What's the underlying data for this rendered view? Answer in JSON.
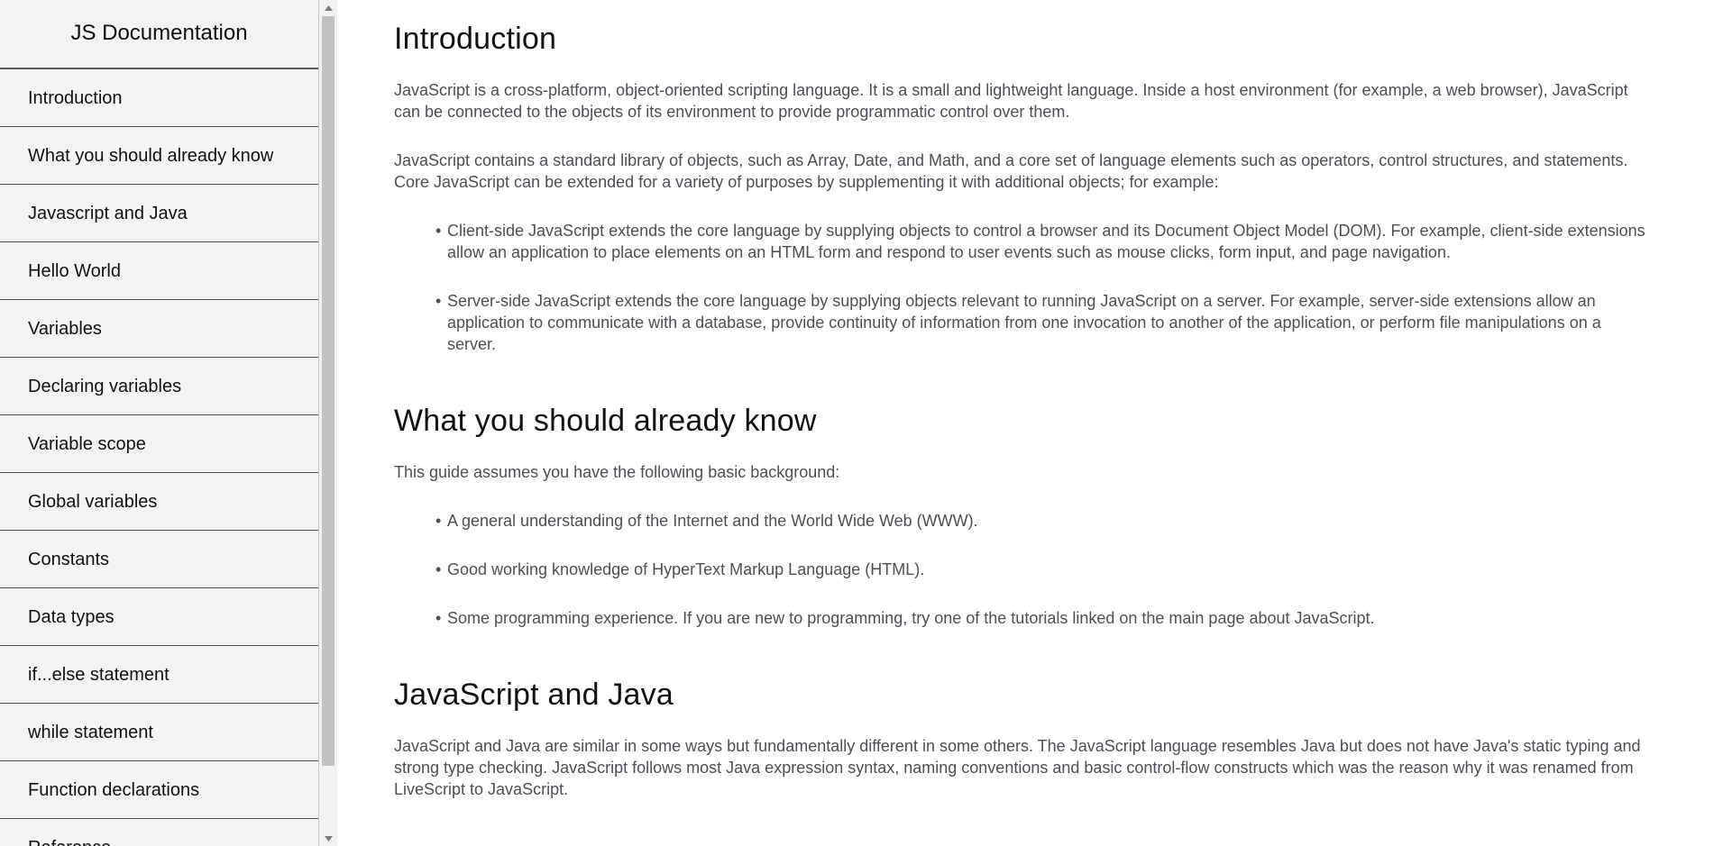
{
  "sidebar": {
    "title": "JS Documentation",
    "items": [
      {
        "label": "Introduction"
      },
      {
        "label": "What you should already know"
      },
      {
        "label": "Javascript and Java"
      },
      {
        "label": "Hello World"
      },
      {
        "label": "Variables"
      },
      {
        "label": "Declaring variables"
      },
      {
        "label": "Variable scope"
      },
      {
        "label": "Global variables"
      },
      {
        "label": "Constants"
      },
      {
        "label": "Data types"
      },
      {
        "label": "if...else statement"
      },
      {
        "label": "while statement"
      },
      {
        "label": "Function declarations"
      },
      {
        "label": "Reference"
      }
    ]
  },
  "scrollbar": {
    "up_icon": "triangle-up",
    "down_icon": "triangle-down"
  },
  "sections": [
    {
      "title": "Introduction",
      "paragraphs": [
        "JavaScript is a cross-platform, object-oriented scripting language. It is a small and lightweight language. Inside a host environment (for example, a web browser), JavaScript can be connected to the objects of its environment to provide programmatic control over them.",
        "JavaScript contains a standard library of objects, such as Array, Date, and Math, and a core set of language elements such as operators, control structures, and statements. Core JavaScript can be extended for a variety of purposes by supplementing it with additional objects; for example:"
      ],
      "bullets": [
        "Client-side JavaScript extends the core language by supplying objects to control a browser and its Document Object Model (DOM). For example, client-side extensions allow an application to place elements on an HTML form and respond to user events such as mouse clicks, form input, and page navigation.",
        "Server-side JavaScript extends the core language by supplying objects relevant to running JavaScript on a server. For example, server-side extensions allow an application to communicate with a database, provide continuity of information from one invocation to another of the application, or perform file manipulations on a server."
      ]
    },
    {
      "title": "What you should already know",
      "paragraphs": [
        "This guide assumes you have the following basic background:"
      ],
      "bullets": [
        "A general understanding of the Internet and the World Wide Web (WWW).",
        "Good working knowledge of HyperText Markup Language (HTML).",
        "Some programming experience. If you are new to programming, try one of the tutorials linked on the main page about JavaScript."
      ]
    },
    {
      "title": "JavaScript and Java",
      "paragraphs": [
        "JavaScript and Java are similar in some ways but fundamentally different in some others. The JavaScript language resembles Java but does not have Java's static typing and strong type checking. JavaScript follows most Java expression syntax, naming conventions and basic control-flow constructs which was the reason why it was renamed from LiveScript to JavaScript."
      ]
    }
  ]
}
